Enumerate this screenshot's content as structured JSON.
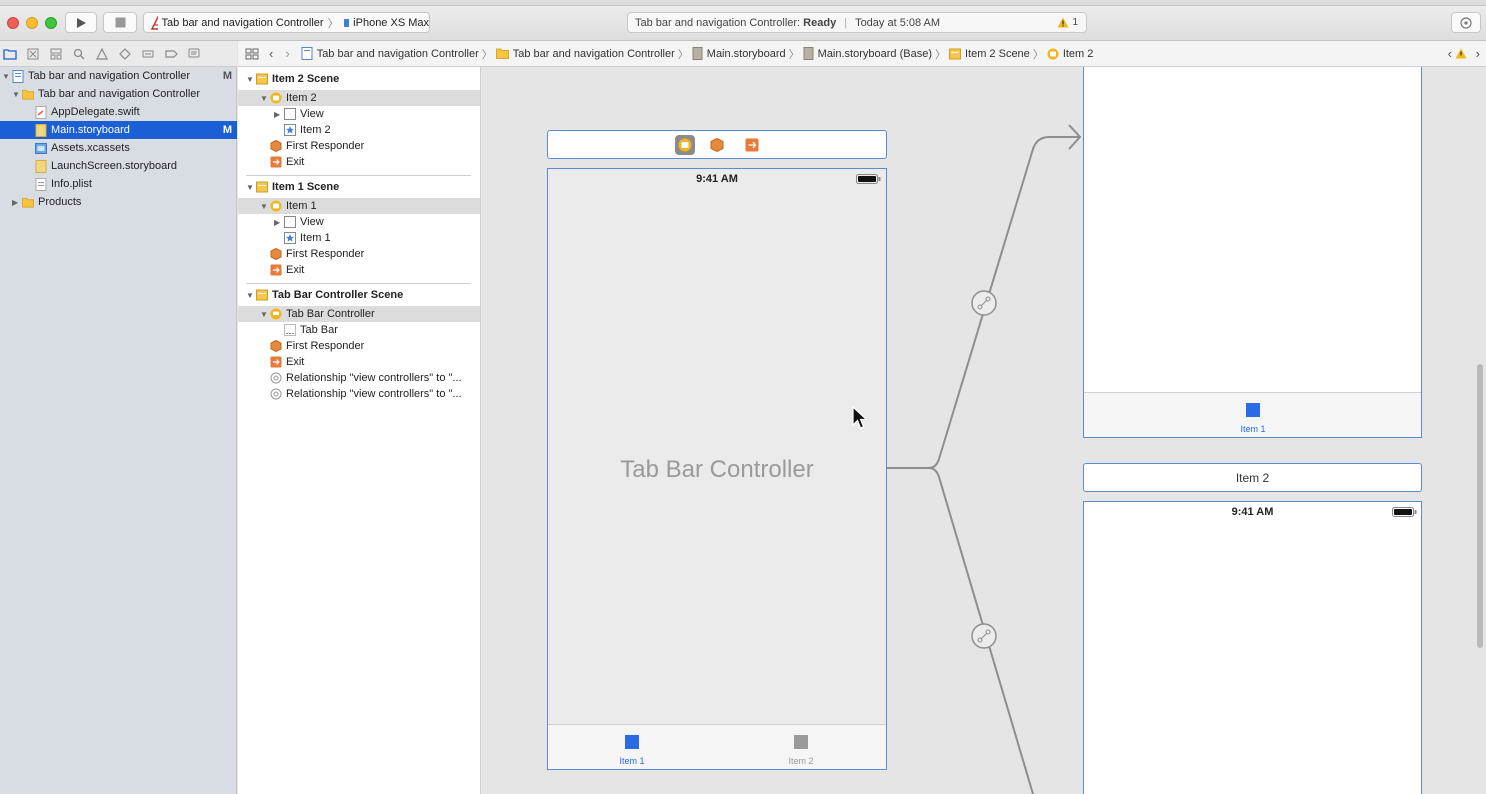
{
  "toolbar": {
    "run_icon": "play-icon",
    "stop_icon": "stop-icon",
    "scheme_target": "Tab bar and navigation Controller",
    "scheme_device": "iPhone XS Max",
    "activity_prefix": "Tab bar and navigation Controller: ",
    "activity_status": "Ready",
    "activity_time": "Today at 5:08 AM",
    "warning_count": "1"
  },
  "jumpbar": {
    "crumbs": [
      "Tab bar and navigation Controller",
      "Tab bar and navigation Controller",
      "Main.storyboard",
      "Main.storyboard (Base)",
      "Item 2 Scene",
      "Item 2"
    ]
  },
  "navigator": {
    "project": "Tab bar and navigation Controller",
    "project_badge": "M",
    "group": "Tab bar and navigation Controller",
    "files": [
      {
        "name": "AppDelegate.swift",
        "badge": ""
      },
      {
        "name": "Main.storyboard",
        "badge": "M"
      },
      {
        "name": "Assets.xcassets",
        "badge": ""
      },
      {
        "name": "LaunchScreen.storyboard",
        "badge": ""
      },
      {
        "name": "Info.plist",
        "badge": ""
      }
    ],
    "products": "Products"
  },
  "outline": {
    "scene2": {
      "title": "Item 2 Scene",
      "controller": "Item 2",
      "view": "View",
      "tabitem": "Item 2",
      "responder": "First Responder",
      "exit": "Exit"
    },
    "scene1": {
      "title": "Item 1 Scene",
      "controller": "Item 1",
      "view": "View",
      "tabitem": "Item 1",
      "responder": "First Responder",
      "exit": "Exit"
    },
    "scene3": {
      "title": "Tab Bar Controller Scene",
      "controller": "Tab Bar Controller",
      "tabbar": "Tab Bar",
      "responder": "First Responder",
      "exit": "Exit",
      "rel1": "Relationship \"view controllers\" to \"...",
      "rel2": "Relationship \"view controllers\" to \"..."
    }
  },
  "canvas": {
    "tbc": {
      "time": "9:41 AM",
      "title": "Tab Bar Controller",
      "tab1": "Item 1",
      "tab2": "Item 2"
    },
    "top_scene": {
      "tab1": "Item 1"
    },
    "item2_scene": {
      "title": "Item 2",
      "time": "9:41 AM"
    }
  },
  "colors": {
    "selection": "#1b5fd6",
    "tab_active": "#2a6ae4",
    "tab_inactive": "#9a9a9a",
    "folder": "#f5c542",
    "storyboard_icon": "#e59a2a"
  }
}
